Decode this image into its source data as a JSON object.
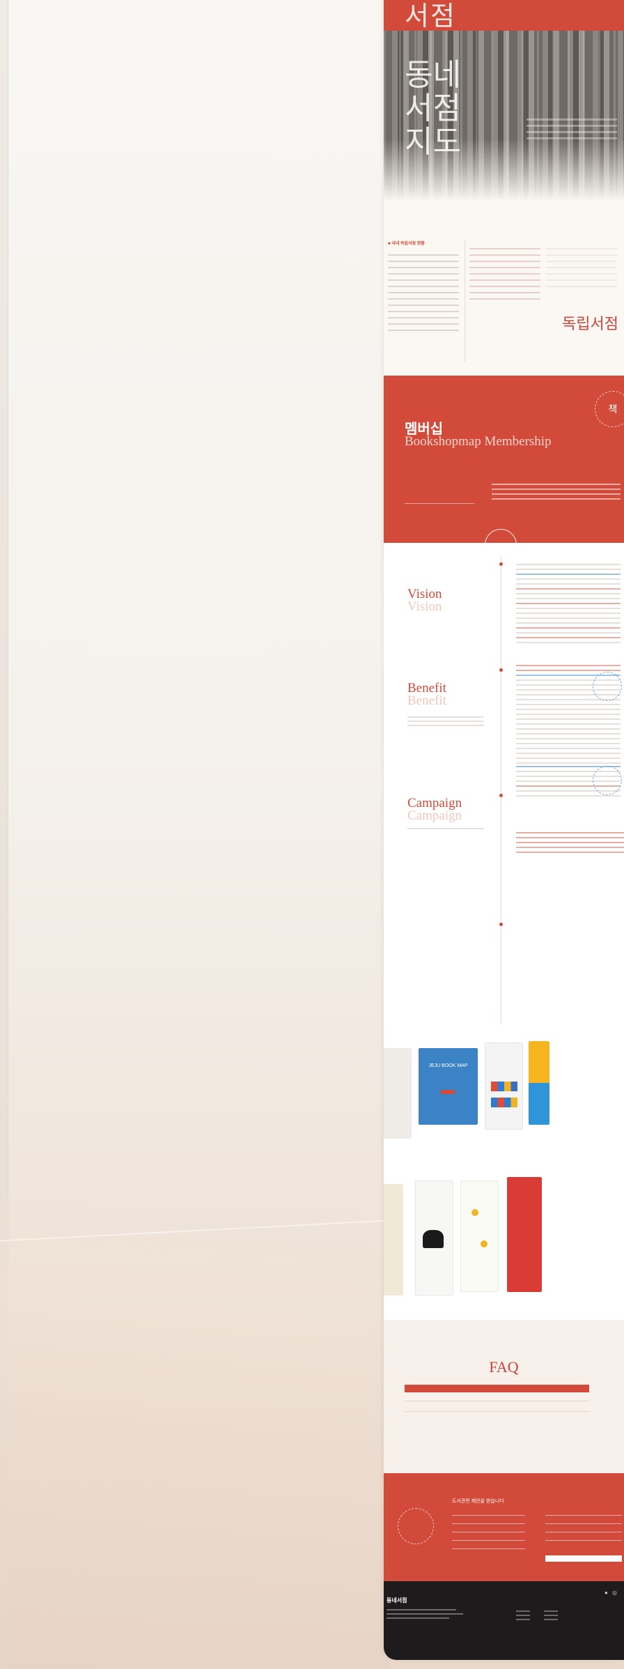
{
  "hero": {
    "top_title": "서점",
    "title_lines": [
      "동네",
      "서점",
      "지도"
    ]
  },
  "intro": {
    "heading": "■ 국내 독립서점 현황",
    "stamp": "독립서점"
  },
  "membership": {
    "title": "멤버십",
    "subtitle": "Bookshopmap Membership",
    "seal_icon": "책"
  },
  "sections": {
    "vision": {
      "title": "Vision",
      "ghost": "Vision"
    },
    "benefit": {
      "title": "Benefit",
      "ghost": "Benefit"
    },
    "campaign": {
      "title": "Campaign",
      "ghost": "Campaign"
    }
  },
  "books": [
    {
      "label": "JEJU BOOK MAP"
    }
  ],
  "faq": {
    "title": "FAQ"
  },
  "contact": {
    "heading": "도서관련 제안을 받습니다"
  },
  "footer": {
    "logo": "동네서점"
  },
  "colors": {
    "accent": "#d24a3a",
    "blue": "#3d82c4"
  }
}
